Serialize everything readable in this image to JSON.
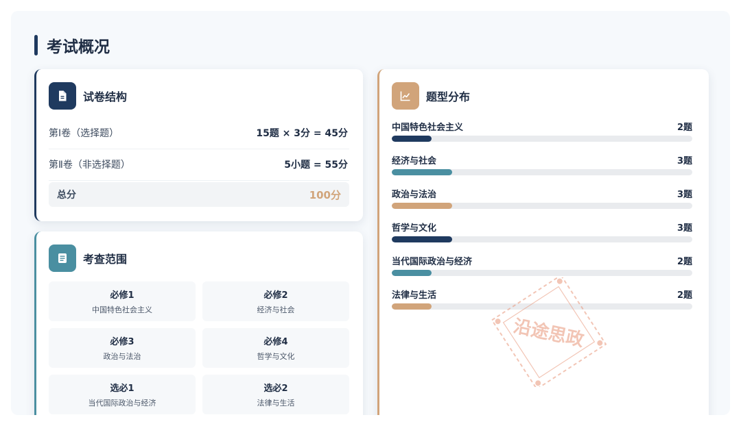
{
  "section_title": "考试概况",
  "structure": {
    "title": "试卷结构",
    "icon": "document-icon",
    "rows": [
      {
        "label": "第Ⅰ卷（选择题）",
        "value": "15题 × 3分 = 45分"
      },
      {
        "label": "第Ⅱ卷（非选择题）",
        "value": "5小题 = 55分"
      }
    ],
    "total": {
      "label": "总分",
      "value": "100分"
    }
  },
  "scope": {
    "title": "考查范围",
    "icon": "list-icon",
    "items": [
      {
        "title": "必修1",
        "subtitle": "中国特色社会主义"
      },
      {
        "title": "必修2",
        "subtitle": "经济与社会"
      },
      {
        "title": "必修3",
        "subtitle": "政治与法治"
      },
      {
        "title": "必修4",
        "subtitle": "哲学与文化"
      },
      {
        "title": "选必1",
        "subtitle": "当代国际政治与经济"
      },
      {
        "title": "选必2",
        "subtitle": "法律与生活"
      }
    ]
  },
  "distribution": {
    "title": "题型分布",
    "icon": "line-chart-icon",
    "max": 15,
    "items": [
      {
        "label": "中国特色社会主义",
        "count_text": "2题",
        "count": 2,
        "color": "#1f3a5f"
      },
      {
        "label": "经济与社会",
        "count_text": "3题",
        "count": 3,
        "color": "#4a8fa1"
      },
      {
        "label": "政治与法治",
        "count_text": "3题",
        "count": 3,
        "color": "#d1a47a"
      },
      {
        "label": "哲学与文化",
        "count_text": "3题",
        "count": 3,
        "color": "#1f3a5f"
      },
      {
        "label": "当代国际政治与经济",
        "count_text": "2题",
        "count": 2,
        "color": "#4a8fa1"
      },
      {
        "label": "法律与生活",
        "count_text": "2题",
        "count": 2,
        "color": "#d1a47a"
      }
    ]
  },
  "watermark": {
    "text": "沿途思政"
  },
  "colors": {
    "navy": "#1f3a5f",
    "teal": "#4a8fa1",
    "tan": "#d1a47a",
    "stamp": "#e8967a"
  }
}
